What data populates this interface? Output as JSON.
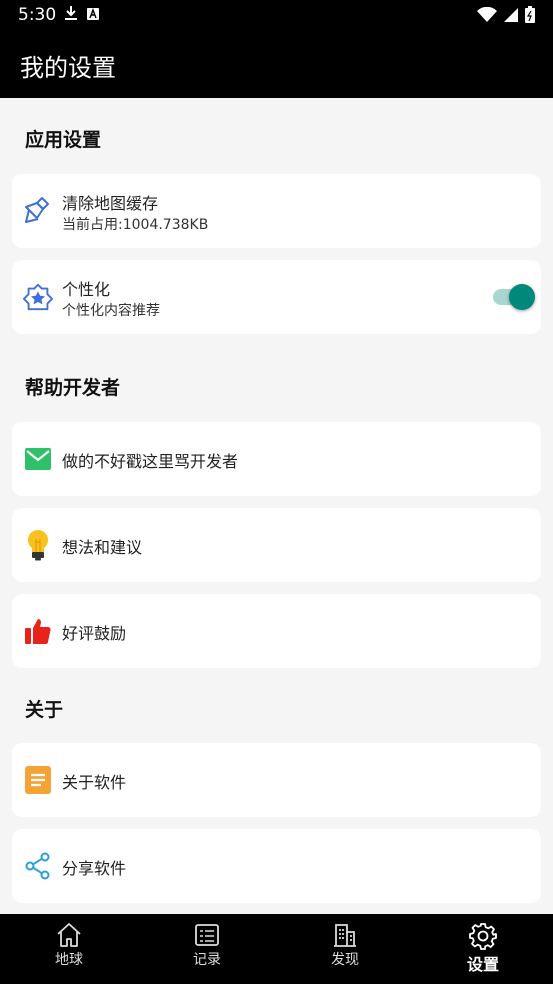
{
  "status_bar": {
    "time": "5:30"
  },
  "app_bar": {
    "title": "我的设置"
  },
  "sections": {
    "app_settings": "应用设置",
    "help_dev": "帮助开发者",
    "about": "关于"
  },
  "items": {
    "clear_cache": {
      "title": "清除地图缓存",
      "subtitle": "当前占用:1004.738KB"
    },
    "personalize": {
      "title": "个性化",
      "subtitle": "个性化内容推荐",
      "enabled": true
    },
    "feedback": {
      "title": "做的不好戳这里骂开发者"
    },
    "ideas": {
      "title": "想法和建议"
    },
    "rate": {
      "title": "好评鼓励"
    },
    "about_app": {
      "title": "关于软件"
    },
    "share": {
      "title": "分享软件"
    }
  },
  "nav": {
    "items": [
      {
        "label": "地球",
        "icon": "home-icon"
      },
      {
        "label": "记录",
        "icon": "list-icon"
      },
      {
        "label": "发现",
        "icon": "building-icon"
      },
      {
        "label": "设置",
        "icon": "gear-icon",
        "active": true
      }
    ]
  },
  "colors": {
    "accent": "#00897b",
    "toggle_track": "#a9d6cf"
  }
}
